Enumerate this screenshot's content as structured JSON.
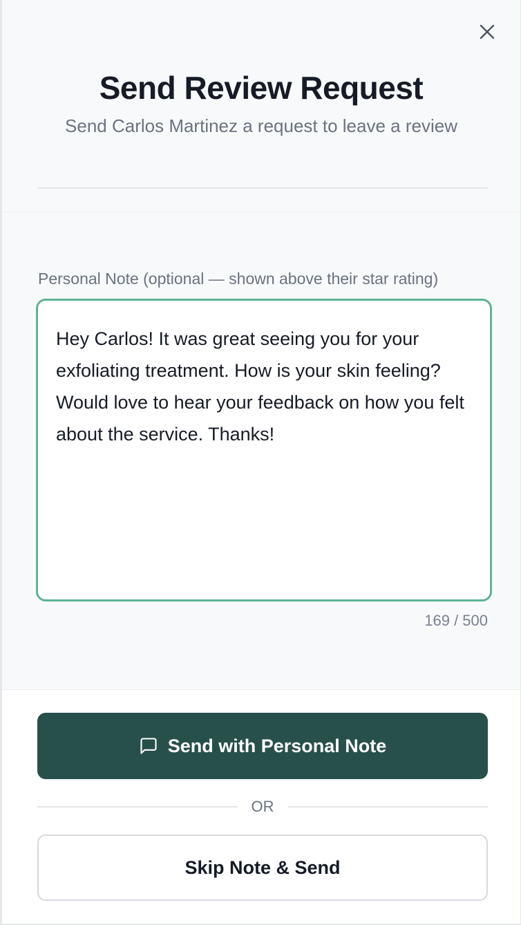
{
  "dialog": {
    "title": "Send Review Request",
    "subtitle": "Send Carlos Martinez a request to leave a review",
    "close_icon": "close-icon"
  },
  "note": {
    "label": "Personal Note (optional — shown above their star rating)",
    "value": "Hey Carlos! It was great seeing you for your exfoliating treatment. How is your skin feeling? Would love to hear your feedback on how you felt about the service. Thanks!",
    "char_count": "169 / 500"
  },
  "actions": {
    "primary_label": "Send with Personal Note",
    "primary_icon": "message-square-icon",
    "or_text": "OR",
    "secondary_label": "Skip Note & Send"
  },
  "colors": {
    "accent_border": "#5cb493",
    "primary_button": "#27504a"
  }
}
